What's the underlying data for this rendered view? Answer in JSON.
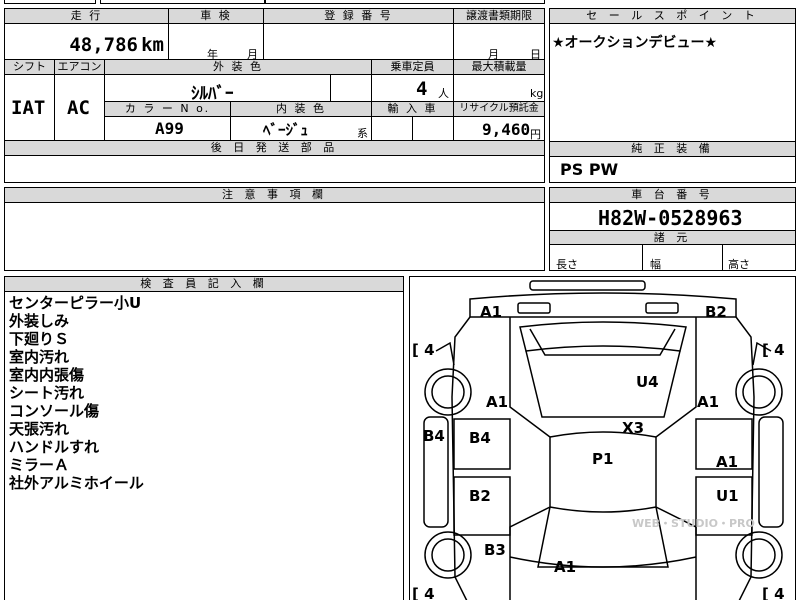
{
  "sheet": {
    "mileage": {
      "label": "走 行",
      "value": "48,786",
      "unit": "km"
    },
    "inspection": {
      "label": "車 検",
      "year_unit": "年",
      "month_unit": "月"
    },
    "registration": {
      "label": "登 録 番 号"
    },
    "transfer_period": {
      "label": "譲渡書類期限",
      "month_unit": "月",
      "day_unit": "日"
    },
    "sales_point": {
      "label": "セ ー ル ス ポ イ ン ト",
      "value": "★オークションデビュー★"
    },
    "shift": {
      "label": "シフト",
      "value": "IAT"
    },
    "aircon": {
      "label": "エアコン",
      "value": "AC"
    },
    "exterior_color": {
      "label": "外 装 色",
      "value": "ｼﾙﾊﾞｰ"
    },
    "capacity": {
      "label": "乗車定員",
      "value": "4",
      "unit": "人"
    },
    "max_load": {
      "label": "最大積載量",
      "unit": "kg"
    },
    "color_no": {
      "label": "カ ラ ー N o.",
      "value": "A99"
    },
    "interior_color": {
      "label": "内 装 色",
      "value": "ﾍﾞｰｼﾞｭ",
      "suffix": "系"
    },
    "import_car": {
      "label": "輸 入 車"
    },
    "recycle_fee": {
      "label": "リサイクル預託金",
      "value": "9,460",
      "unit": "円"
    },
    "later_parts": {
      "label": "後 日 発 送 部 品"
    },
    "standard_equipment": {
      "label": "純 正 装 備",
      "value": "PS PW"
    },
    "caution": {
      "label": "注 意 事 項 欄"
    },
    "chassis_no": {
      "label": "車 台 番 号",
      "value": "H82W-0528963"
    },
    "specs": {
      "label": "諸 元",
      "length": "長さ",
      "width": "幅",
      "height": "高さ"
    },
    "inspector": {
      "label": "検 査 員 記 入 欄",
      "notes": [
        "センターピラー小U",
        "外装しみ",
        "下廻りＳ",
        "室内汚れ",
        "室内内張傷",
        "シート汚れ",
        "コンソール傷",
        "天張汚れ",
        "ハンドルすれ",
        "ミラーＡ",
        "社外アルミホイール"
      ]
    }
  },
  "diagram": {
    "marks": [
      "A1",
      "B2",
      "U4",
      "A1",
      "A1",
      "X3",
      "B4",
      "B4",
      "P1",
      "A1",
      "B2",
      "U1",
      "B3",
      "A1"
    ],
    "tires": [
      "[ 4",
      "[ 4",
      "[ 4",
      "[ 4"
    ],
    "watermark": "WEB・STUDIO・PRO"
  }
}
